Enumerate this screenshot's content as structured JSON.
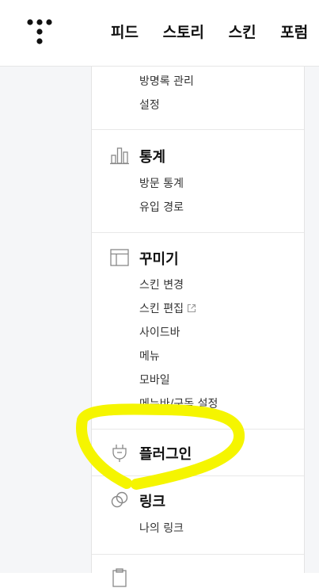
{
  "header": {
    "logo_icon": "tistory-dots-logo-icon",
    "nav": [
      "피드",
      "스토리",
      "스킨",
      "포럼"
    ]
  },
  "menu": {
    "partial_section": {
      "items": [
        "방명록 관리",
        "설정"
      ]
    },
    "stats": {
      "title": "통계",
      "icon": "bar-chart-icon",
      "items": [
        "방문 통계",
        "유입 경로"
      ]
    },
    "design": {
      "title": "꾸미기",
      "icon": "layout-icon",
      "items": [
        "스킨 변경",
        "스킨 편집",
        "사이드바",
        "메뉴",
        "모바일",
        "메뉴바/구독 설정"
      ]
    },
    "plugin": {
      "title": "플러그인",
      "icon": "plug-icon"
    },
    "link": {
      "title": "링크",
      "icon": "link-icon",
      "items": [
        "나의 링크"
      ]
    }
  },
  "annotation": {
    "color": "#f5f500"
  }
}
